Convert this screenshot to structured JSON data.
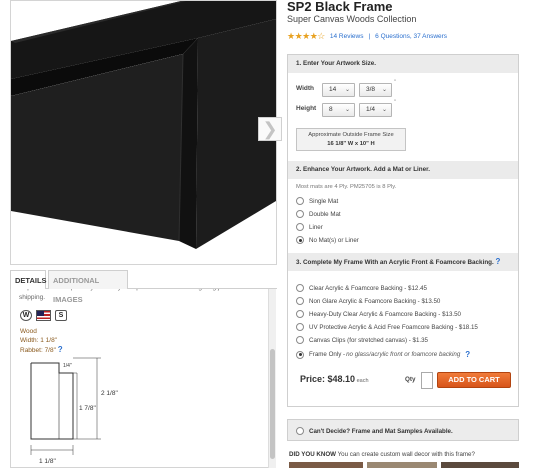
{
  "product": {
    "title": "SP2 Black Frame",
    "subtitle": "Super Canvas Woods Collection",
    "stars": "★★★★☆",
    "reviews_link": "14 Reviews",
    "separator": "|",
    "qa_link": "6 Questions, 37 Answers"
  },
  "gallery": {
    "next_glyph": "❯"
  },
  "tabs": {
    "details": "DETAILS",
    "additional_images": "ADDITIONAL IMAGES"
  },
  "details": {
    "description": "Unpaid as sold separately. Our way with pictureframes.com. Lighting just shipping.",
    "badges": [
      "W",
      "S"
    ],
    "wood": "Wood",
    "width": "Width: 1 1/8\"",
    "rabbet": "Rabbet: 7/8\"",
    "help": "?",
    "profile_dims": {
      "top_small": "1/4\"",
      "top_right": "2 1/8\"",
      "mid": "1 7/8\"",
      "bottom": "1 1/8\""
    }
  },
  "step1": {
    "heading": "1. Enter Your Artwork Size.",
    "width_label": "Width",
    "height_label": "Height",
    "width_whole": "14",
    "width_fraction": "3/8",
    "height_whole": "8",
    "height_fraction": "1/4",
    "inch_mark": "\"",
    "outside_label": "Approximate Outside Frame Size",
    "outside_value": "16 1/8\" W x 10\" H"
  },
  "step2": {
    "heading": "2. Enhance Your Artwork. Add a Mat or Liner.",
    "note": "Most mats are 4 Ply. PM25705 is 8 Ply.",
    "options": [
      "Single Mat",
      "Double Mat",
      "Liner",
      "No Mat(s) or Liner"
    ],
    "selected_index": 3
  },
  "step3": {
    "heading": "3. Complete My Frame With an Acrylic Front & Foamcore Backing.",
    "help": "?",
    "options": [
      "Clear Acrylic & Foamcore Backing - $12.45",
      "Non Glare Acrylic & Foamcore Backing - $13.50",
      "Heavy-Duty Clear Acrylic & Foamcore Backing - $13.50",
      "UV Protective Acrylic & Acid Free Foamcore Backing - $18.15",
      "Canvas Clips (for stretched canvas) - $1.35"
    ],
    "frame_only_label": "Frame Only - ",
    "frame_only_note": "no glass/acrylic front or foamcore backing",
    "selected": "frame-only"
  },
  "purchase": {
    "price_label": "Price: $48.10",
    "each": " each",
    "qty_label": "Qty",
    "qty_value": "",
    "cart_button": "ADD TO CART"
  },
  "samples": {
    "label": "Can't Decide? Frame and Mat Samples Available."
  },
  "did_you_know": {
    "prefix": "DID YOU KNOW",
    "text": " You can create custom wall decor with this frame?"
  },
  "colors": {
    "link_blue": "#2a6fce",
    "star_gold": "#e8a120",
    "cart_orange": "#e0622a",
    "section_gray": "#ebebeb"
  }
}
